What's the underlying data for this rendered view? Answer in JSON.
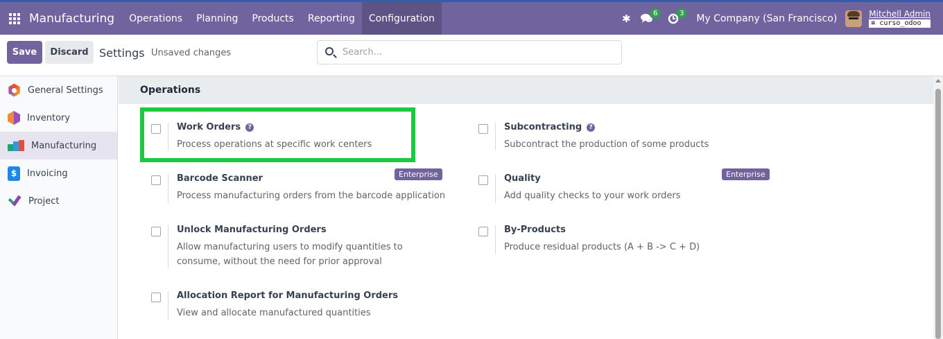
{
  "navbar": {
    "app_name": "Manufacturing",
    "menu": [
      {
        "label": "Operations"
      },
      {
        "label": "Planning"
      },
      {
        "label": "Products"
      },
      {
        "label": "Reporting"
      },
      {
        "label": "Configuration"
      }
    ],
    "messages_count": "6",
    "activities_count": "3",
    "company": "My Company (San Francisco)",
    "user_name": "Mitchell Admin",
    "database": "curso_odoo"
  },
  "control": {
    "save_label": "Save",
    "discard_label": "Discard",
    "title": "Settings",
    "status": "Unsaved changes",
    "search_placeholder": "Search..."
  },
  "sidebar": {
    "items": [
      {
        "label": "General Settings"
      },
      {
        "label": "Inventory"
      },
      {
        "label": "Manufacturing"
      },
      {
        "label": "Invoicing"
      },
      {
        "label": "Project"
      }
    ]
  },
  "section": {
    "title": "Operations",
    "settings": [
      {
        "title": "Work Orders",
        "description": "Process operations at specific work centers"
      },
      {
        "title": "Subcontracting",
        "description": "Subcontract the production of some products"
      },
      {
        "title": "Barcode Scanner",
        "description": "Process manufacturing orders from the barcode application",
        "badge": "Enterprise"
      },
      {
        "title": "Quality",
        "description": "Add quality checks to your work orders",
        "badge": "Enterprise"
      },
      {
        "title": "Unlock Manufacturing Orders",
        "description": "Allow manufacturing users to modify quantities to consume, without the need for prior approval"
      },
      {
        "title": "By-Products",
        "description": "Produce residual products (A + B -> C + D)"
      },
      {
        "title": "Allocation Report for Manufacturing Orders",
        "description": "View and allocate manufactured quantities"
      }
    ]
  },
  "colors": {
    "navbar": "#71639e",
    "highlight": "#1ec941",
    "primary": "#71639e"
  }
}
